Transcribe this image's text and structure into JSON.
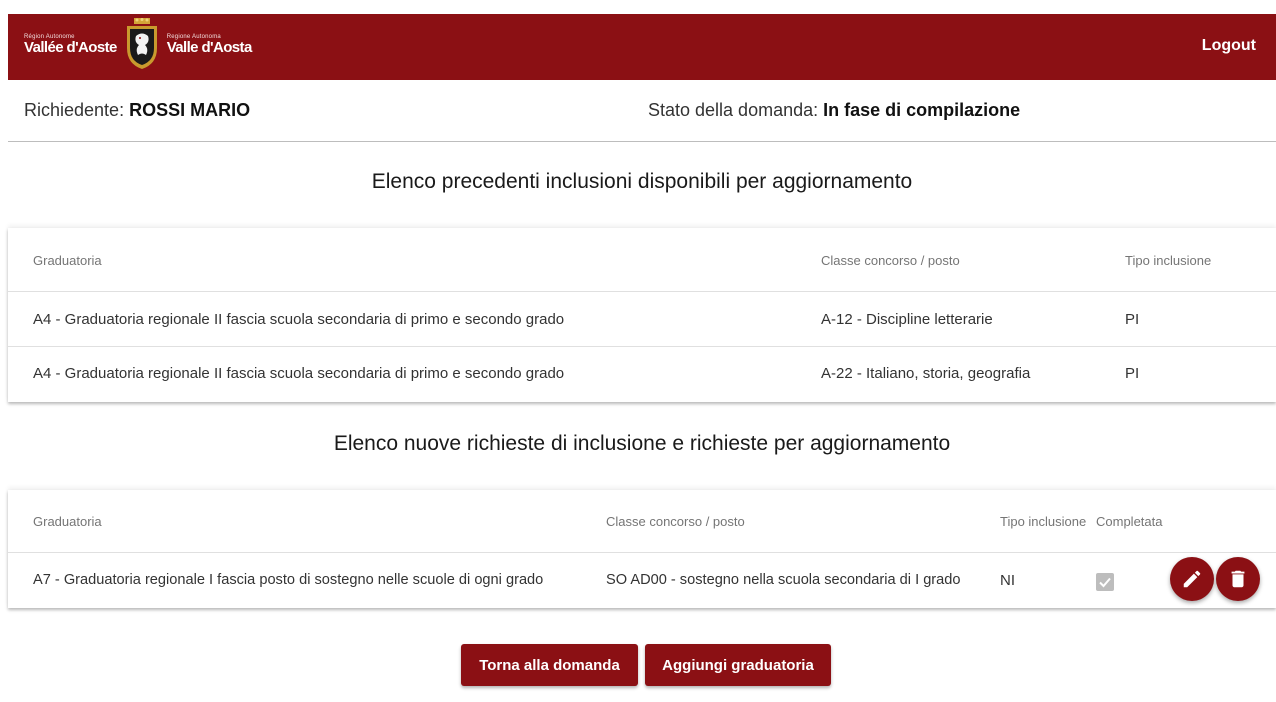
{
  "header": {
    "logo_left_small": "Région Autonome",
    "logo_left_big": "Vallée d'Aoste",
    "logo_right_small": "Regione Autonoma",
    "logo_right_big": "Valle d'Aosta",
    "logout_label": "Logout",
    "brand_color": "#8b1014"
  },
  "info": {
    "richiedente_label": "Richiedente:",
    "richiedente_value": "ROSSI MARIO",
    "stato_label": "Stato della domanda:",
    "stato_value": "In fase di compilazione"
  },
  "section1": {
    "title": "Elenco precedenti inclusioni disponibili per aggiornamento",
    "columns": [
      "Graduatoria",
      "Classe concorso / posto",
      "Tipo inclusione"
    ],
    "rows": [
      [
        "A4 - Graduatoria regionale II fascia scuola secondaria di primo e secondo grado",
        "A-12 - Discipline letterarie",
        "PI"
      ],
      [
        "A4 - Graduatoria regionale II fascia scuola secondaria di primo e secondo grado",
        "A-22 - Italiano, storia, geografia",
        "PI"
      ]
    ]
  },
  "section2": {
    "title": "Elenco nuove richieste di inclusione e richieste per aggiornamento",
    "columns": [
      "Graduatoria",
      "Classe concorso / posto",
      "Tipo inclusione",
      "Completata"
    ],
    "rows": [
      {
        "graduatoria": "A7 - Graduatoria regionale I fascia posto di sostegno nelle scuole di ogni grado",
        "classe": "SO AD00 - sostegno nella scuola secondaria di I grado",
        "tipo": "NI",
        "completata": true,
        "edit_icon": "pencil-icon",
        "delete_icon": "trash-icon"
      }
    ]
  },
  "actions": {
    "back_label": "Torna alla domanda",
    "add_label": "Aggiungi graduatoria"
  }
}
